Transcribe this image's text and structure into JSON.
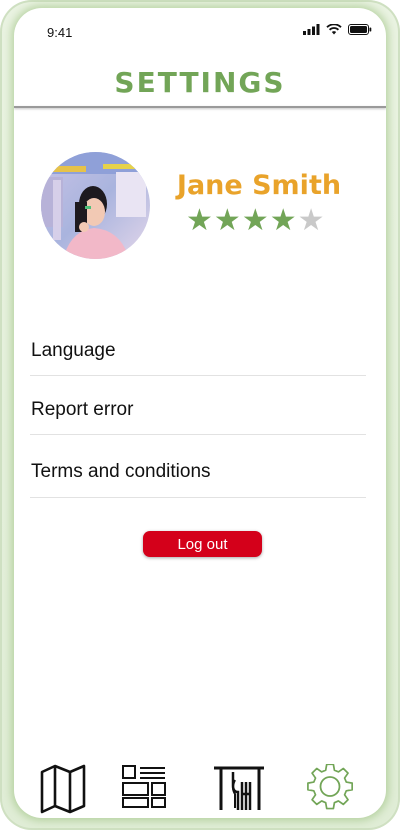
{
  "status_bar": {
    "time": "9:41"
  },
  "header": {
    "title": "SETTINGS"
  },
  "profile": {
    "name": "Jane Smith",
    "rating": 4,
    "rating_max": 5,
    "star_color": "#72a557",
    "star_empty_color": "#c9c9c9",
    "name_color": "#e9a32a"
  },
  "menu": {
    "items": [
      {
        "label": "Language"
      },
      {
        "label": "Report error"
      },
      {
        "label": "Terms and conditions"
      }
    ]
  },
  "logout": {
    "label": "Log out",
    "color": "#d4001a"
  },
  "nav": {
    "items": [
      {
        "icon": "map-icon"
      },
      {
        "icon": "layout-icon"
      },
      {
        "icon": "restaurant-icon"
      },
      {
        "icon": "gear-icon",
        "active": true
      }
    ],
    "active_color": "#72a557"
  }
}
